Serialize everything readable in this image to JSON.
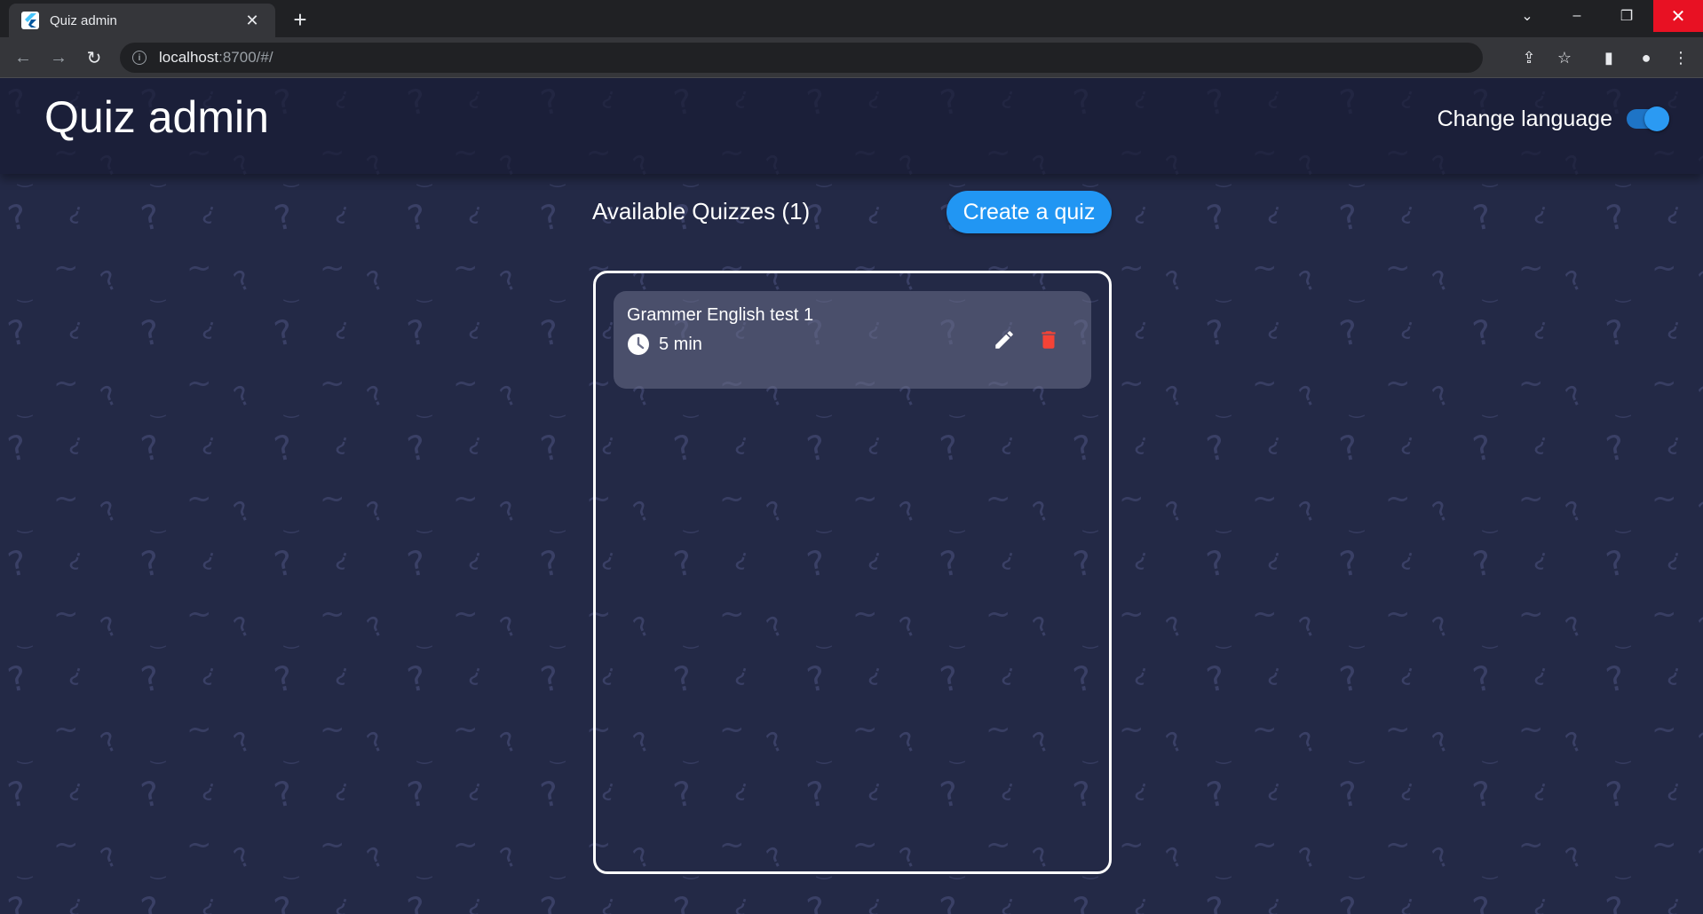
{
  "browser": {
    "tab_title": "Quiz admin",
    "url_host": "localhost",
    "url_rest": ":8700/#/"
  },
  "app": {
    "title": "Quiz admin",
    "change_language_label": "Change language",
    "language_toggle_on": true,
    "accent_color": "#2196f3",
    "background_color": "#232946"
  },
  "quizzes": {
    "heading": "Available Quizzes (1)",
    "create_button_label": "Create a quiz",
    "items": [
      {
        "name": "Grammer English test 1",
        "duration": "5 min",
        "icons": [
          "clock-icon",
          "edit-icon",
          "delete-icon"
        ]
      }
    ]
  }
}
